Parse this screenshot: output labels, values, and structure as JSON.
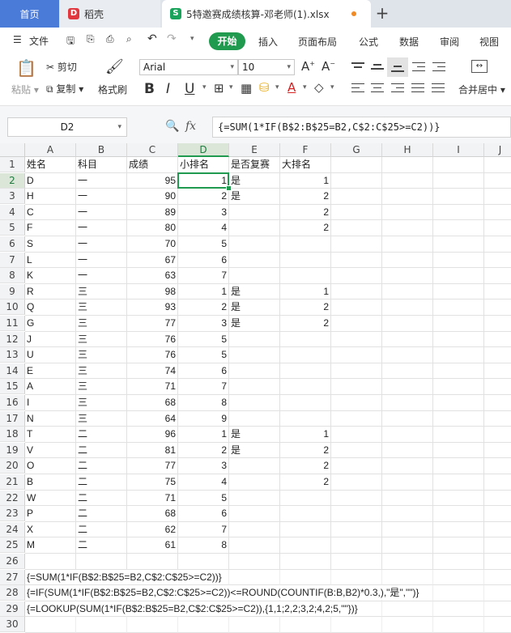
{
  "tabs": {
    "home": "首页",
    "doc": "稻壳",
    "file": "5特邀赛成绩核算-邓老师(1).xlsx"
  },
  "menu": {
    "file": "文件",
    "items": [
      "开始",
      "插入",
      "页面布局",
      "公式",
      "数据",
      "审阅",
      "视图"
    ]
  },
  "ribbon": {
    "paste": "粘贴",
    "cut": "剪切",
    "copy": "复制",
    "format_painter": "格式刷",
    "font_name": "Arial",
    "font_size": "10",
    "merge": "合并居中"
  },
  "formula_bar": {
    "name_box": "D2",
    "fx": "fx",
    "formula": "{=SUM(1*IF(B$2:B$25=B2,C$2:C$25>=C2))}"
  },
  "sheet": {
    "columns": [
      "A",
      "B",
      "C",
      "D",
      "E",
      "F",
      "G",
      "H",
      "I",
      "J"
    ],
    "header_row": [
      "姓名",
      "科目",
      "成绩",
      "小排名",
      "是否复赛",
      "大排名"
    ],
    "rows": [
      [
        "D",
        "一",
        "95",
        "1",
        "是",
        "1"
      ],
      [
        "H",
        "一",
        "90",
        "2",
        "是",
        "2"
      ],
      [
        "C",
        "一",
        "89",
        "3",
        "",
        "2"
      ],
      [
        "F",
        "一",
        "80",
        "4",
        "",
        "2"
      ],
      [
        "S",
        "一",
        "70",
        "5",
        "",
        ""
      ],
      [
        "L",
        "一",
        "67",
        "6",
        "",
        ""
      ],
      [
        "K",
        "一",
        "63",
        "7",
        "",
        ""
      ],
      [
        "R",
        "三",
        "98",
        "1",
        "是",
        "1"
      ],
      [
        "Q",
        "三",
        "93",
        "2",
        "是",
        "2"
      ],
      [
        "G",
        "三",
        "77",
        "3",
        "是",
        "2"
      ],
      [
        "J",
        "三",
        "76",
        "5",
        "",
        ""
      ],
      [
        "U",
        "三",
        "76",
        "5",
        "",
        ""
      ],
      [
        "E",
        "三",
        "74",
        "6",
        "",
        ""
      ],
      [
        "A",
        "三",
        "71",
        "7",
        "",
        ""
      ],
      [
        "I",
        "三",
        "68",
        "8",
        "",
        ""
      ],
      [
        "N",
        "三",
        "64",
        "9",
        "",
        ""
      ],
      [
        "T",
        "二",
        "96",
        "1",
        "是",
        "1"
      ],
      [
        "V",
        "二",
        "81",
        "2",
        "是",
        "2"
      ],
      [
        "O",
        "二",
        "77",
        "3",
        "",
        "2"
      ],
      [
        "B",
        "二",
        "75",
        "4",
        "",
        "2"
      ],
      [
        "W",
        "二",
        "71",
        "5",
        "",
        ""
      ],
      [
        "P",
        "二",
        "68",
        "6",
        "",
        ""
      ],
      [
        "X",
        "二",
        "62",
        "7",
        "",
        ""
      ],
      [
        "M",
        "二",
        "61",
        "8",
        "",
        ""
      ]
    ],
    "formula_notes": [
      "{=SUM(1*IF(B$2:B$25=B2,C$2:C$25>=C2))}",
      "{=IF(SUM(1*IF(B$2:B$25=B2,C$2:C$25>=C2))<=ROUND(COUNTIF(B:B,B2)*0.3,),\"是\",\"\")}",
      "{=LOOKUP(SUM(1*IF(B$2:B$25=B2,C$2:C$25>=C2)),{1,1;2,2;3,2;4,2;5,\"\"})}"
    ],
    "active_cell": "D2"
  },
  "colors": {
    "accent": "#1f9a4e",
    "home_tab": "#4a7bd8"
  }
}
